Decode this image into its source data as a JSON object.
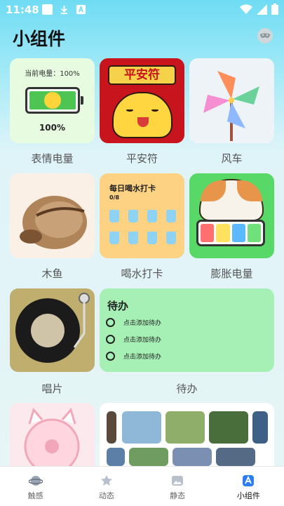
{
  "status": {
    "time": "11:48"
  },
  "header": {
    "title": "小组件"
  },
  "widgets": {
    "battery": {
      "label": "表情电量",
      "text": "当前电量：100%",
      "percent": "100%",
      "level": 1.0
    },
    "amulet": {
      "label": "平安符",
      "text": "平安符"
    },
    "pinwheel": {
      "label": "风车"
    },
    "fish": {
      "label": "木鱼"
    },
    "water": {
      "label": "喝水打卡",
      "title": "每日喝水打卡",
      "progress": "0/8",
      "goal_cups": 8
    },
    "swell": {
      "label": "膨胀电量"
    },
    "record": {
      "label": "唱片"
    },
    "todo": {
      "label": "待办",
      "title": "待办",
      "items": [
        "点击添加待办",
        "点击添加待办",
        "点击添加待办"
      ]
    }
  },
  "tabs": [
    {
      "label": "触感",
      "icon": "planet-icon"
    },
    {
      "label": "动态",
      "icon": "star-cat-icon"
    },
    {
      "label": "静态",
      "icon": "image-icon"
    },
    {
      "label": "小组件",
      "icon": "widget-icon",
      "active": true
    }
  ],
  "colors": {
    "accent": "#2c7cf6",
    "todo_bg": "#a6f0b6",
    "water_bg": "#fdd283"
  }
}
